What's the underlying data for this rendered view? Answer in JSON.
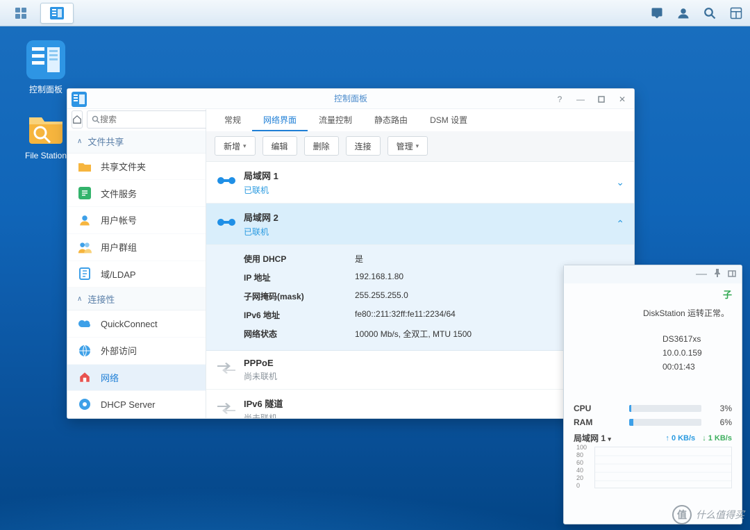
{
  "desktop": {
    "icons": [
      {
        "label": "控制面板"
      },
      {
        "label": "File Station"
      }
    ]
  },
  "window": {
    "title": "控制面板",
    "search_placeholder": "搜索",
    "categories": {
      "file_share": "文件共享",
      "connectivity": "连接性"
    },
    "sidebar": {
      "shared_folder": "共享文件夹",
      "file_service": "文件服务",
      "user_account": "用户帐号",
      "user_group": "用户群组",
      "domain_ldap": "域/LDAP",
      "quickconnect": "QuickConnect",
      "external_access": "外部访问",
      "network": "网络",
      "dhcp_server": "DHCP Server"
    },
    "tabs": {
      "general": "常规",
      "iface": "网络界面",
      "traffic": "流量控制",
      "static_route": "静态路由",
      "dsm_settings": "DSM 设置"
    },
    "toolbar": {
      "new": "新增",
      "edit": "编辑",
      "delete": "删除",
      "connect": "连接",
      "manage": "管理"
    },
    "ifaces": {
      "lan1": {
        "name": "局域网 1",
        "status": "已联机"
      },
      "lan2": {
        "name": "局域网 2",
        "status": "已联机",
        "details": {
          "use_dhcp_k": "使用 DHCP",
          "use_dhcp_v": "是",
          "ip_k": "IP 地址",
          "ip_v": "192.168.1.80",
          "mask_k": "子网掩码(mask)",
          "mask_v": "255.255.255.0",
          "ipv6_k": "IPv6 地址",
          "ipv6_v": "fe80::211:32ff:fe11:2234/64",
          "netstat_k": "网络状态",
          "netstat_v": "10000 Mb/s, 全双工, MTU 1500"
        }
      },
      "pppoe": {
        "name": "PPPoE",
        "status": "尚未联机"
      },
      "ipv6t": {
        "name": "IPv6 隧道",
        "status": "尚未联机"
      }
    }
  },
  "widget": {
    "station_ok": "DiskStation 运转正常。",
    "model": "DS3617xs",
    "ip": "10.0.0.159",
    "uptime": "00:01:43",
    "cpu_label": "CPU",
    "cpu_pct": "3%",
    "ram_label": "RAM",
    "ram_pct": "6%",
    "net_label": "局域网 1",
    "up": "0 KB/s",
    "down": "1 KB/s",
    "yticks": "100\n80\n60\n40\n20\n0"
  },
  "watermark": {
    "char": "值",
    "text": "什么值得买"
  },
  "partial_char": "子"
}
